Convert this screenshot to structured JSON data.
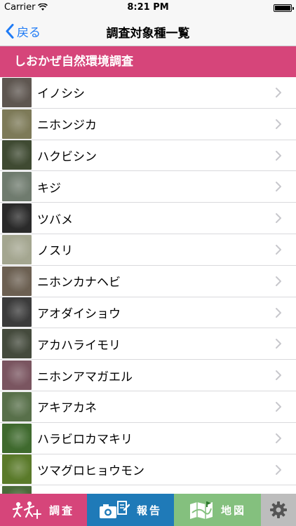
{
  "status_bar": {
    "carrier": "Carrier",
    "time": "8:21 PM"
  },
  "nav": {
    "back_label": "戻る",
    "title": "調査対象種一覧"
  },
  "section": {
    "title": "しおかぜ自然環境調査"
  },
  "species": [
    {
      "name": "イノシシ",
      "thumb": "#5e5650"
    },
    {
      "name": "ニホンジカ",
      "thumb": "#7d7a58"
    },
    {
      "name": "ハクビシン",
      "thumb": "#3f4a32"
    },
    {
      "name": "キジ",
      "thumb": "#6f7b6e"
    },
    {
      "name": "ツバメ",
      "thumb": "#2a2a2a"
    },
    {
      "name": "ノスリ",
      "thumb": "#a4a690"
    },
    {
      "name": "ニホンカナヘビ",
      "thumb": "#6c6052"
    },
    {
      "name": "アオダイショウ",
      "thumb": "#3b3b3b"
    },
    {
      "name": "アカハライモリ",
      "thumb": "#444a3c"
    },
    {
      "name": "ニホンアマガエル",
      "thumb": "#7a5560"
    },
    {
      "name": "アキアカネ",
      "thumb": "#58704a"
    },
    {
      "name": "ハラビロカマキリ",
      "thumb": "#3f6a2e"
    },
    {
      "name": "ツマグロヒョウモン",
      "thumb": "#5a7a2a"
    },
    {
      "name": "",
      "thumb": "#4a6a3a"
    }
  ],
  "tabs": {
    "survey": "調査",
    "report": "報告",
    "map": "地図"
  },
  "colors": {
    "accent": "#d6457a",
    "link": "#1f7bf6",
    "report": "#1f7ab8",
    "map": "#84c07e",
    "settings": "#bdbdbd"
  },
  "icons": {
    "survey": "survey-figures-icon",
    "report": "camera-document-icon",
    "map": "map-icon",
    "settings": "gear-icon"
  }
}
